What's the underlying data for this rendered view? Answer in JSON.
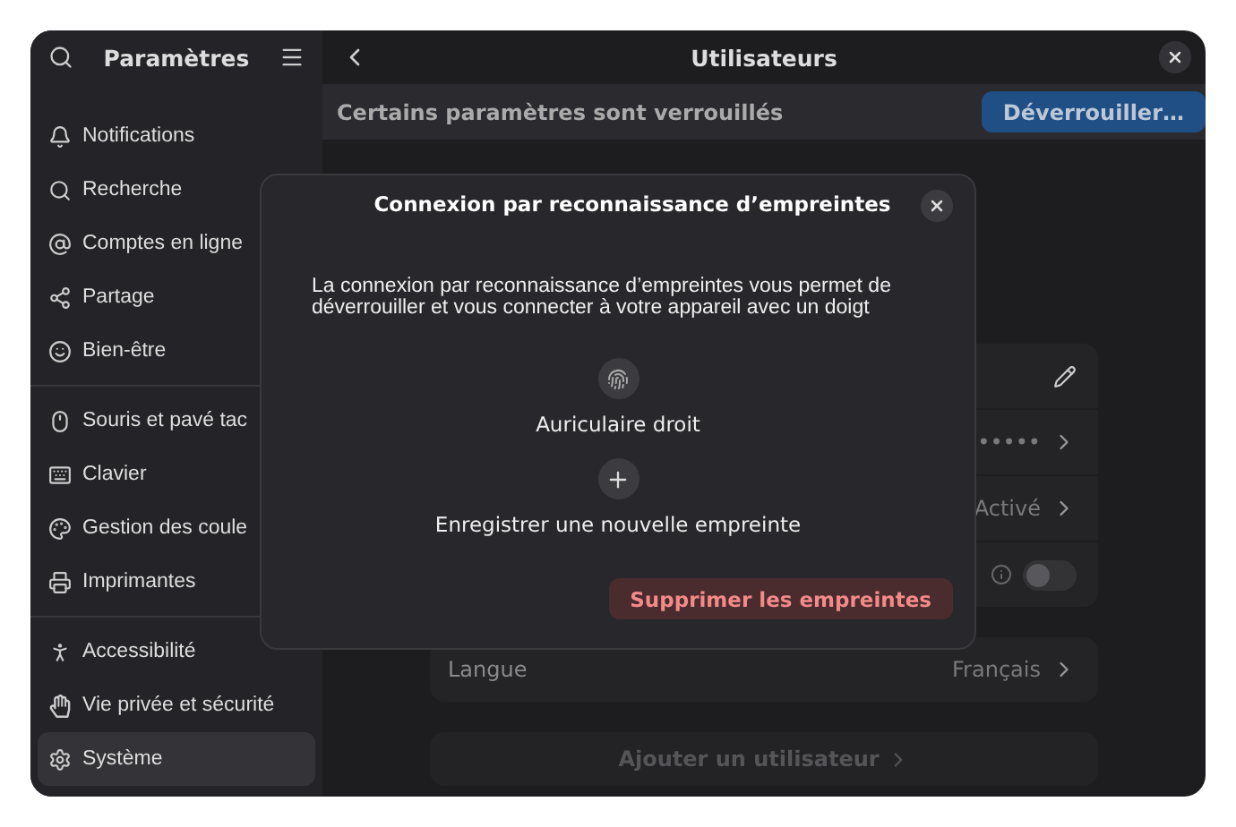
{
  "sidebar": {
    "title": "Paramètres",
    "groups": [
      [
        {
          "label": "Notifications",
          "selected": false
        },
        {
          "label": "Recherche",
          "selected": false
        },
        {
          "label": "Comptes en ligne",
          "selected": false
        },
        {
          "label": "Partage",
          "selected": false
        },
        {
          "label": "Bien-être",
          "selected": false
        }
      ],
      [
        {
          "label": "Souris et pavé tac",
          "selected": false
        },
        {
          "label": "Clavier",
          "selected": false
        },
        {
          "label": "Gestion des coule",
          "selected": false
        },
        {
          "label": "Imprimantes",
          "selected": false
        }
      ],
      [
        {
          "label": "Accessibilité",
          "selected": false
        },
        {
          "label": "Vie privée et sécurité",
          "selected": false
        },
        {
          "label": "Système",
          "selected": true
        }
      ]
    ]
  },
  "main": {
    "title": "Utilisateurs",
    "banner": {
      "text": "Certains paramètres sont verrouillés",
      "button": "Déverrouiller…"
    },
    "rows": [
      {
        "kind": "edit"
      },
      {
        "kind": "value",
        "value": "•••••"
      },
      {
        "kind": "value",
        "value": "Activé"
      },
      {
        "kind": "toggle",
        "on": false
      }
    ],
    "language": {
      "label": "Langue",
      "value": "Français"
    },
    "add_button": "Ajouter un utilisateur"
  },
  "dialog": {
    "title": "Connexion par reconnaissance d’empreintes",
    "description": "La connexion par reconnaissance d’empreintes vous permet de déverrouiller et vous connecter à votre appareil avec un doigt",
    "fingerprints": [
      {
        "label": "Auriculaire droit"
      }
    ],
    "add_label": "Enregistrer une nouvelle empreinte",
    "delete_button": "Supprimer les empreintes"
  }
}
